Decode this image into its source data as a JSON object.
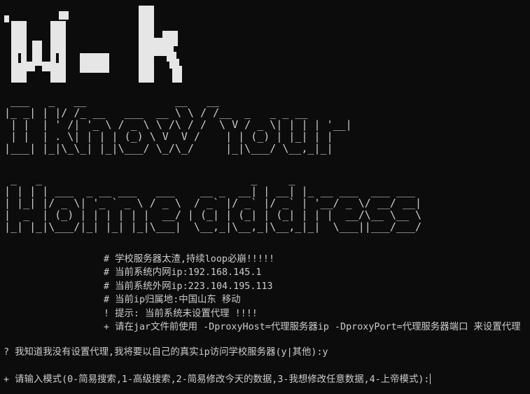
{
  "window": {
    "background": "#0c0c0c",
    "foreground": "#cccccc"
  },
  "banner": {
    "logo_text": "W-k",
    "ascii_line_1": " ___   _   __              __   __\n|_ _| | |/ /_ __   ___  __ \\ \\ / /__  _   _ _ __\n | |  | ' /| '_ \\ / _ \\ \\ /\\ / /  \\ V / _ \\| | | | '__|\n | |  | . \\| | | | (_) \\ V  V /    | | (_) | |_| | |\n|___| |_|\\_\\_| |_|\\___/ \\_/\\_/     |_|\\___/ \\__,_|_|",
    "ascii_line_2": " _   _                                 _     _\n| | | | ___  _ __ ___   ___    __ _  __| | __| |_ __ ___  ___ ___\n| |_| |/ _ \\| '_ ` _ \\ / _ \\  / _` |/ _` |/ _` | '__/ _ \\/ __/ __|\n|  _  | (_) | | | | | |  __/ | (_| | (_| | (_| | | |  __/\\__ \\__ \\\n|_| |_|\\___/|_| |_| |_|\\___|  \\__,_|\\__,_|\\__,_|_|  \\___||___/___/"
  },
  "info": {
    "line1": "# 学校服务器太渣,持续loop必崩!!!!!",
    "line2": "# 当前系统内网ip:192.168.145.1",
    "line3": "# 当前系统外网ip:223.104.195.113",
    "line4": "# 当前ip归属地:中国山东 移动",
    "line5": "! 提示: 当前系统未设置代理 !!!!",
    "line6": "+ 请在jar文件前使用 -DproxyHost=代理服务器ip -DproxyPort=代理服务器端口 来设置代理"
  },
  "prompts": {
    "question": "? 我知道我没有设置代理,我将要以自己的真实ip访问学校服务器(y|其他):y",
    "mode": "+ 请输入模式(0-简易搜索,1-高级搜索,2-简易修改今天的数据,3-我想修改任意数据,4-上帝模式):"
  }
}
